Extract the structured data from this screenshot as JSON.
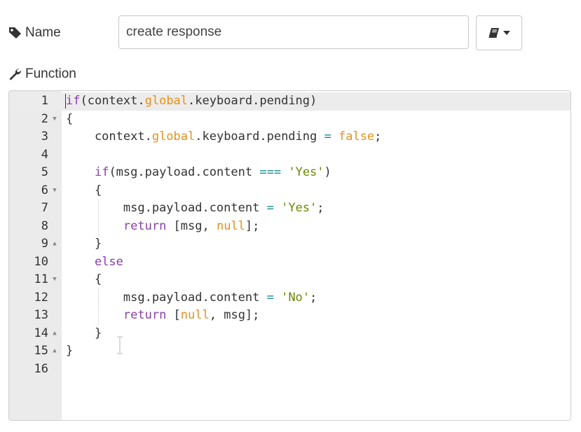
{
  "form": {
    "name_label": "Name",
    "name_value": "create response",
    "function_label": "Function",
    "library_button_icon": "book-icon",
    "library_caret_icon": "caret-down-icon"
  },
  "editor": {
    "lines": [
      {
        "n": "1",
        "fold": "",
        "code": [
          [
            "k",
            "if"
          ],
          [
            "p",
            "(context."
          ],
          [
            "g",
            "global"
          ],
          [
            "p",
            ".keyboard.pending)"
          ]
        ]
      },
      {
        "n": "2",
        "fold": "down",
        "code": [
          [
            "p",
            "{"
          ]
        ]
      },
      {
        "n": "3",
        "fold": "",
        "code": [
          [
            "p",
            "    context."
          ],
          [
            "g",
            "global"
          ],
          [
            "p",
            ".keyboard.pending "
          ],
          [
            "o",
            "="
          ],
          [
            "p",
            " "
          ],
          [
            "n",
            "false"
          ],
          [
            "p",
            ";"
          ]
        ]
      },
      {
        "n": "4",
        "fold": "",
        "code": []
      },
      {
        "n": "5",
        "fold": "",
        "code": [
          [
            "p",
            "    "
          ],
          [
            "k",
            "if"
          ],
          [
            "p",
            "(msg.payload.content "
          ],
          [
            "o",
            "==="
          ],
          [
            "p",
            " "
          ],
          [
            "s",
            "'Yes'"
          ],
          [
            "p",
            ")"
          ]
        ]
      },
      {
        "n": "6",
        "fold": "down",
        "code": [
          [
            "p",
            "    {"
          ]
        ]
      },
      {
        "n": "7",
        "fold": "",
        "code": [
          [
            "p",
            "        msg.payload.content "
          ],
          [
            "o",
            "="
          ],
          [
            "p",
            " "
          ],
          [
            "s",
            "'Yes'"
          ],
          [
            "p",
            ";"
          ]
        ]
      },
      {
        "n": "8",
        "fold": "",
        "code": [
          [
            "p",
            "        "
          ],
          [
            "k",
            "return"
          ],
          [
            "p",
            " [msg, "
          ],
          [
            "n",
            "null"
          ],
          [
            "p",
            "];"
          ]
        ]
      },
      {
        "n": "9",
        "fold": "up",
        "code": [
          [
            "p",
            "    }"
          ]
        ]
      },
      {
        "n": "10",
        "fold": "",
        "code": [
          [
            "p",
            "    "
          ],
          [
            "k",
            "else"
          ]
        ]
      },
      {
        "n": "11",
        "fold": "down",
        "code": [
          [
            "p",
            "    {"
          ]
        ]
      },
      {
        "n": "12",
        "fold": "",
        "code": [
          [
            "p",
            "        msg.payload.content "
          ],
          [
            "o",
            "="
          ],
          [
            "p",
            " "
          ],
          [
            "s",
            "'No'"
          ],
          [
            "p",
            ";"
          ]
        ]
      },
      {
        "n": "13",
        "fold": "",
        "code": [
          [
            "p",
            "        "
          ],
          [
            "k",
            "return"
          ],
          [
            "p",
            " ["
          ],
          [
            "n",
            "null"
          ],
          [
            "p",
            ", msg];"
          ]
        ]
      },
      {
        "n": "14",
        "fold": "up",
        "code": [
          [
            "p",
            "    }"
          ]
        ]
      },
      {
        "n": "15",
        "fold": "up",
        "code": [
          [
            "p",
            "}"
          ]
        ]
      },
      {
        "n": "16",
        "fold": "",
        "code": []
      }
    ]
  },
  "colors": {
    "keyword": "#8a3fa8",
    "global": "#e8901a",
    "string": "#6a8a00",
    "operator": "#1a8a8a",
    "gutter_bg": "#ebebeb"
  }
}
